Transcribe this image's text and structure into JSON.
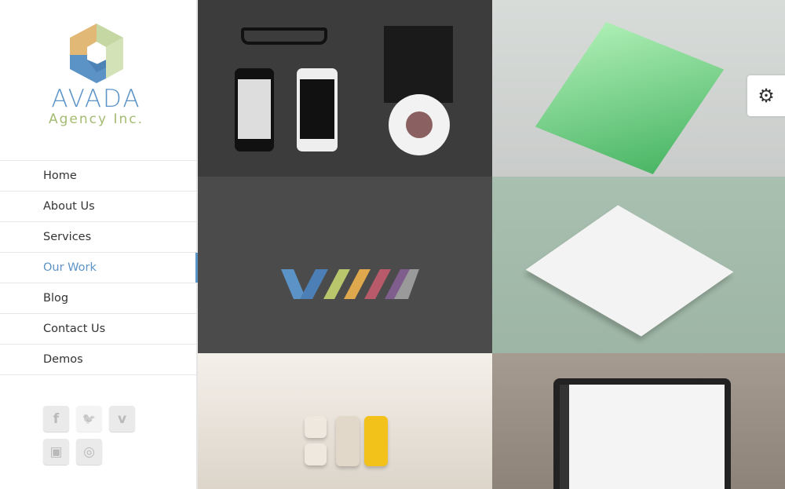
{
  "logo": {
    "brand": "AVADA",
    "tagline": "Agency Inc."
  },
  "nav": {
    "items": [
      {
        "label": "Home"
      },
      {
        "label": "About Us"
      },
      {
        "label": "Services"
      },
      {
        "label": "Our Work",
        "active": true
      },
      {
        "label": "Blog"
      },
      {
        "label": "Contact Us"
      },
      {
        "label": "Demos"
      }
    ]
  },
  "social": [
    {
      "name": "facebook-icon",
      "glyph": "f"
    },
    {
      "name": "twitter-icon",
      "glyph": "🐦"
    },
    {
      "name": "vimeo-icon",
      "glyph": "v"
    },
    {
      "name": "instagram-icon",
      "glyph": "▣"
    },
    {
      "name": "dribbble-icon",
      "glyph": "◎"
    }
  ],
  "portfolio": [
    "Stationery & phone mockup",
    "Phone app screen",
    "Striped logo",
    "Paper layout",
    "Toggle switches",
    "Laptop dashboard"
  ],
  "colors": {
    "accent": "#5b93c7",
    "green": "#a4bb72"
  },
  "settings": {
    "icon": "gear-icon",
    "glyph": "⚙"
  }
}
